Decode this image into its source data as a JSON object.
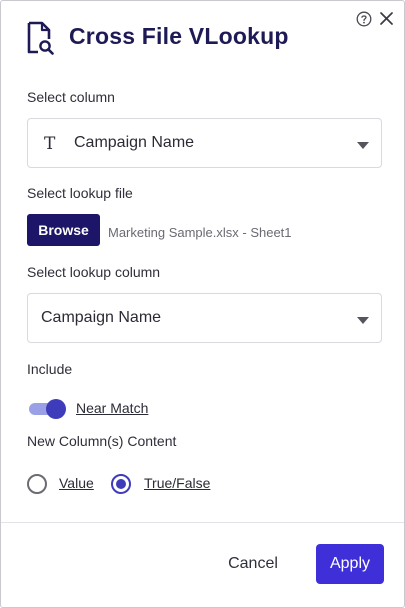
{
  "header": {
    "title": "Cross File VLookup",
    "title_icon": "file-search-icon",
    "help_icon": "help-circle-icon",
    "close_icon": "close-icon"
  },
  "select_column": {
    "label": "Select column",
    "type_icon": "T",
    "value": "Campaign Name"
  },
  "lookup_file": {
    "label": "Select lookup file",
    "browse_label": "Browse",
    "file_name": "Marketing Sample.xlsx - Sheet1"
  },
  "lookup_column": {
    "label": "Select lookup column",
    "value": "Campaign Name"
  },
  "include": {
    "label": "Include",
    "toggle_label": "Near Match",
    "toggle_on": true
  },
  "content": {
    "label": "New Column(s) Content",
    "options": [
      {
        "label": "Value",
        "selected": false
      },
      {
        "label": "True/False",
        "selected": true
      }
    ]
  },
  "footer": {
    "cancel_label": "Cancel",
    "apply_label": "Apply"
  },
  "colors": {
    "primary_dark": "#1d1567",
    "accent": "#3f3cbb",
    "apply": "#3f2fd9"
  }
}
